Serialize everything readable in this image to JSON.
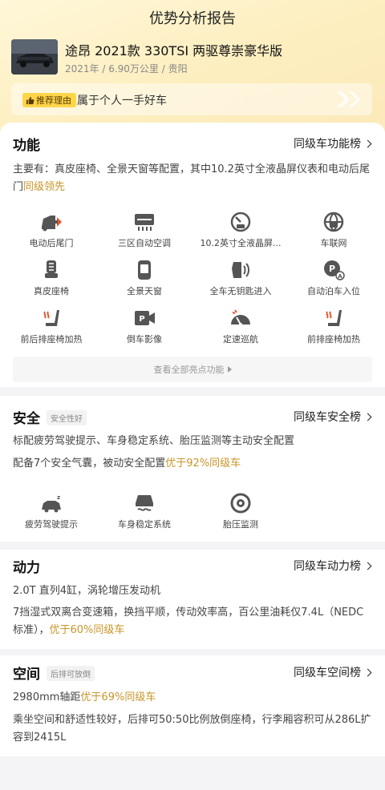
{
  "header": {
    "title": "优势分析报告"
  },
  "car": {
    "name": "途昂 2021款 330TSI 两驱尊崇豪华版",
    "meta": "2021年 / 6.90万公里 / 贵阳"
  },
  "reason": {
    "tag": "推荐理由",
    "text": "属于个人一手好车"
  },
  "function_section": {
    "title": "功能",
    "link": "同级车功能榜",
    "desc_main": "主要有：真皮座椅、全景天窗等配置，其中10.2英寸全液晶屏仪表和电动后尾门",
    "desc_highlight": "同级领先",
    "features": [
      {
        "label": "电动后尾门",
        "icon": "tailgate-icon"
      },
      {
        "label": "三区自动空调",
        "icon": "ac-icon"
      },
      {
        "label": "10.2英寸全液晶屏...",
        "icon": "lcd-icon"
      },
      {
        "label": "车联网",
        "icon": "globe-icon"
      },
      {
        "label": "真皮座椅",
        "icon": "seat-icon"
      },
      {
        "label": "全景天窗",
        "icon": "sunroof-icon"
      },
      {
        "label": "全车无钥匙进入",
        "icon": "keyless-icon"
      },
      {
        "label": "自动泊车入位",
        "icon": "parking-icon"
      },
      {
        "label": "前后排座椅加热",
        "icon": "seat-heat-icon"
      },
      {
        "label": "倒车影像",
        "icon": "reverse-camera-icon"
      },
      {
        "label": "定速巡航",
        "icon": "cruise-icon"
      },
      {
        "label": "前排座椅加热",
        "icon": "seat-heat-icon"
      }
    ],
    "view_all": "查看全部亮点功能"
  },
  "safety_section": {
    "title": "安全",
    "tag": "安全性好",
    "link": "同级车安全榜",
    "line1": "标配疲劳驾驶提示、车身稳定系统、胎压监测等主动安全配置",
    "line2_main": "配备7个安全气囊，被动安全配置",
    "line2_highlight": "优于92%同级车",
    "features": [
      {
        "label": "疲劳驾驶提示",
        "icon": "fatigue-icon"
      },
      {
        "label": "车身稳定系统",
        "icon": "stability-icon"
      },
      {
        "label": "胎压监测",
        "icon": "tire-pressure-icon"
      }
    ]
  },
  "power_section": {
    "title": "动力",
    "link": "同级车动力榜",
    "line1": "2.0T 直列4缸，涡轮增压发动机",
    "line2_main": "7挡湿式双离合变速箱，换挡平顺，传动效率高，百公里油耗仅7.4L（NEDC标准），",
    "line2_highlight": "优于60%同级车"
  },
  "space_section": {
    "title": "空间",
    "tag": "后排可放倒",
    "link": "同级车空间榜",
    "line1_main": "2980mm轴距",
    "line1_highlight": "优于69%同级车",
    "line2": "乘坐空间和舒适性较好，后排可50:50比例放倒座椅，行李厢容积可从286L扩容到2415L"
  },
  "colors": {
    "accent": "#c8962a",
    "tag_yellow": "#ffd54a",
    "hero_bg": "#fdefc1"
  }
}
